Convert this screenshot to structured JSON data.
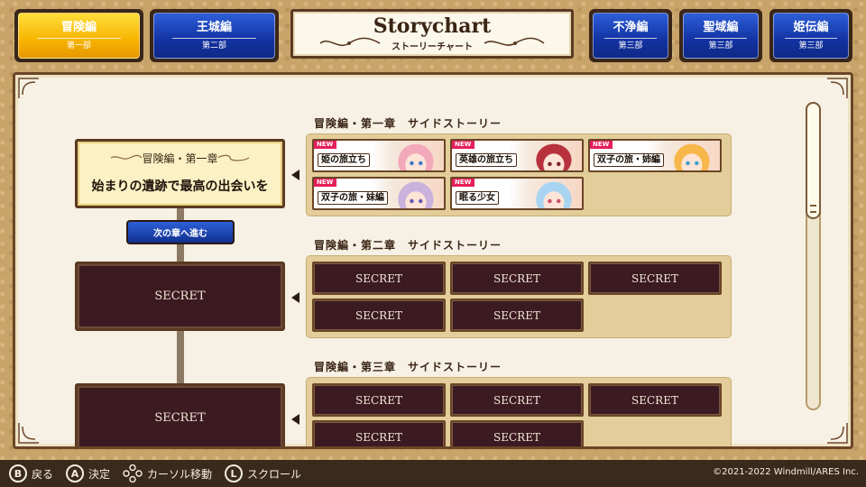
{
  "tabs": [
    {
      "label": "冒険編",
      "sub": "第一部",
      "style": "gold"
    },
    {
      "label": "王城編",
      "sub": "第二部",
      "style": "blue"
    },
    {
      "label": "不浄編",
      "sub": "第三部",
      "style": "blue"
    },
    {
      "label": "聖域編",
      "sub": "第三部",
      "style": "blue"
    },
    {
      "label": "姫伝編",
      "sub": "第三部",
      "style": "blue"
    }
  ],
  "header": {
    "title": "Storychart",
    "subtitle": "ストーリーチャート"
  },
  "chapters": [
    {
      "sub": "冒険編・第一章",
      "title": "始まりの遺跡で最高の出会いを"
    },
    {
      "secret": "SECRET"
    },
    {
      "secret": "SECRET"
    }
  ],
  "next_chapter_button": "次の章へ進む",
  "sections": [
    {
      "title": "冒険編・第一章　サイドストーリー",
      "stories": [
        {
          "label": "姫の旅立ち",
          "badge": "NEW"
        },
        {
          "label": "英雄の旅立ち",
          "badge": "NEW"
        },
        {
          "label": "双子の旅・姉編",
          "badge": "NEW"
        },
        {
          "label": "双子の旅・妹編",
          "badge": "NEW"
        },
        {
          "label": "眠る少女",
          "badge": "NEW"
        }
      ]
    },
    {
      "title": "冒険編・第二章　サイドストーリー",
      "stories": [
        "SECRET",
        "SECRET",
        "SECRET",
        "SECRET",
        "SECRET"
      ]
    },
    {
      "title": "冒険編・第三章　サイドストーリー",
      "stories": [
        "SECRET",
        "SECRET",
        "SECRET",
        "SECRET",
        "SECRET"
      ]
    }
  ],
  "controls": [
    {
      "button": "B",
      "label": "戻る"
    },
    {
      "button": "A",
      "label": "決定"
    },
    {
      "button": "dpad",
      "label": "カーソル移動"
    },
    {
      "button": "L",
      "label": "スクロール"
    }
  ],
  "copyright": "©2021-2022 Windmill/ARES Inc.",
  "colors": {
    "gold_tab": "#f7b400",
    "blue_tab": "#1232a2",
    "secret_bg": "#3c1a22",
    "new_badge": "#e61e5a",
    "frame": "#5a3a22"
  }
}
